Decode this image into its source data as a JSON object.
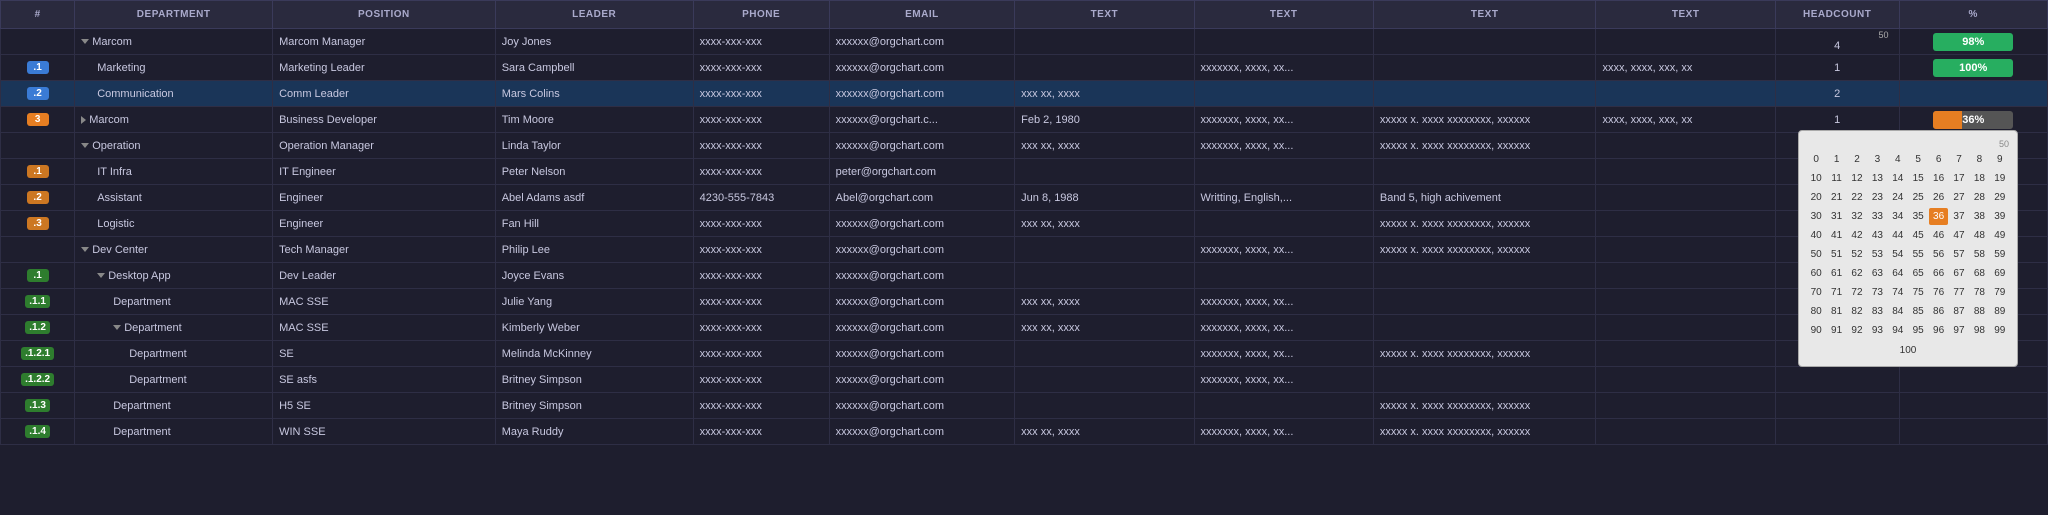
{
  "header": {
    "cols": [
      "#",
      "DEPARTMENT",
      "POSITION",
      "LEADER",
      "PHONE",
      "EMAIL",
      "TEXT",
      "TEXT",
      "TEXT",
      "TEXT",
      "HEADCOUNT",
      "%"
    ]
  },
  "headcount_50": "50",
  "rows": [
    {
      "id": "",
      "depth": 0,
      "dept": "Marcom",
      "pos": "Marcom Manager",
      "leader": "Joy Jones",
      "phone": "xxxx-xxx-xxx",
      "email": "xxxxxx@orgchart.com",
      "t1": "",
      "t2": "",
      "t3": "",
      "t4": "",
      "hc": "4",
      "pct": 98,
      "pct_label": "98%",
      "badge_color": "blue",
      "has_arrow": true,
      "arrow_type": "down",
      "row_style": ""
    },
    {
      "id": ".1",
      "depth": 1,
      "dept": "Marketing",
      "pos": "Marketing Leader",
      "leader": "Sara Campbell",
      "phone": "xxxx-xxx-xxx",
      "email": "xxxxxx@orgchart.com",
      "t1": "",
      "t2": "xxxxxxx, xxxx, xx...",
      "t3": "",
      "t4": "xxxx, xxxx, xxx, xx",
      "hc": "1",
      "pct": 100,
      "pct_label": "100%",
      "badge_color": "blue",
      "has_arrow": false,
      "row_style": "blue-indent"
    },
    {
      "id": ".2",
      "depth": 1,
      "dept": "Communication",
      "pos": "Comm Leader",
      "leader": "Mars Colins",
      "phone": "xxxx-xxx-xxx",
      "email": "xxxxxx@orgchart.com",
      "t1": "xxx xx, xxxx",
      "t2": "",
      "t3": "",
      "t4": "",
      "hc": "2",
      "pct": null,
      "pct_label": "",
      "badge_color": "blue",
      "has_arrow": false,
      "row_style": "selected-blue"
    },
    {
      "id": "3",
      "depth": 0,
      "dept": "Marcom",
      "pos": "Business Developer",
      "leader": "Tim Moore",
      "phone": "xxxx-xxx-xxx",
      "email": "xxxxxx@orgchart.c...",
      "t1": "Feb 2, 1980",
      "t2": "xxxxxxx, xxxx, xx...",
      "t3": "xxxxx x. xxxx xxxxxxxx, xxxxxx",
      "t4": "xxxx, xxxx, xxx, xx",
      "hc": "1",
      "pct": 36,
      "pct_label": "36%",
      "badge_color": "orange",
      "has_arrow": true,
      "arrow_type": "right",
      "row_style": ""
    },
    {
      "id": "",
      "depth": 0,
      "dept": "Operation",
      "pos": "Operation Manager",
      "leader": "Linda Taylor",
      "phone": "xxxx-xxx-xxx",
      "email": "xxxxxx@orgchart.com",
      "t1": "xxx xx, xxxx",
      "t2": "xxxxxxx, xxxx, xx...",
      "t3": "xxxxx x. xxxx xxxxxxxx, xxxxxx",
      "t4": "",
      "hc": "",
      "pct": null,
      "pct_label": "",
      "badge_color": "",
      "has_arrow": true,
      "arrow_type": "down",
      "row_style": ""
    },
    {
      "id": ".1",
      "depth": 1,
      "dept": "IT Infra",
      "pos": "IT Engineer",
      "leader": "Peter Nelson",
      "phone": "xxxx-xxx-xxx",
      "email": "peter@orgchart.com",
      "t1": "",
      "t2": "",
      "t3": "",
      "t4": "",
      "hc": "",
      "pct": null,
      "pct_label": "",
      "badge_color": "orange-ind",
      "has_arrow": false,
      "row_style": ""
    },
    {
      "id": ".2",
      "depth": 1,
      "dept": "Assistant",
      "pos": "Engineer",
      "leader": "Abel Adams asdf",
      "phone": "4230-555-7843",
      "email": "Abel@orgchart.com",
      "t1": "Jun 8, 1988",
      "t2": "Writting, English,...",
      "t3": "Band 5, high achivement",
      "t4": "",
      "hc": "",
      "pct": null,
      "pct_label": "",
      "badge_color": "orange-ind",
      "has_arrow": false,
      "row_style": ""
    },
    {
      "id": ".3",
      "depth": 1,
      "dept": "Logistic",
      "pos": "Engineer",
      "leader": "Fan Hill",
      "phone": "xxxx-xxx-xxx",
      "email": "xxxxxx@orgchart.com",
      "t1": "xxx xx, xxxx",
      "t2": "",
      "t3": "xxxxx x. xxxx xxxxxxxx, xxxxxx",
      "t4": "",
      "hc": "",
      "pct": null,
      "pct_label": "",
      "badge_color": "orange-ind",
      "has_arrow": false,
      "row_style": ""
    },
    {
      "id": "",
      "depth": 0,
      "dept": "Dev Center",
      "pos": "Tech Manager",
      "leader": "Philip Lee",
      "phone": "xxxx-xxx-xxx",
      "email": "xxxxxx@orgchart.com",
      "t1": "",
      "t2": "xxxxxxx, xxxx, xx...",
      "t3": "xxxxx x. xxxx xxxxxxxx, xxxxxx",
      "t4": "",
      "hc": "",
      "pct": null,
      "pct_label": "",
      "badge_color": "green-ind",
      "has_arrow": true,
      "arrow_type": "down",
      "row_style": ""
    },
    {
      "id": ".1",
      "depth": 1,
      "dept": "Desktop App",
      "pos": "Dev Leader",
      "leader": "Joyce Evans",
      "phone": "xxxx-xxx-xxx",
      "email": "xxxxxx@orgchart.com",
      "t1": "",
      "t2": "",
      "t3": "",
      "t4": "",
      "hc": "",
      "pct": null,
      "pct_label": "",
      "badge_color": "green-ind",
      "has_arrow": true,
      "arrow_type": "down",
      "row_style": ""
    },
    {
      "id": ".1.1",
      "depth": 2,
      "dept": "Department",
      "pos": "MAC SSE",
      "leader": "Julie Yang",
      "phone": "xxxx-xxx-xxx",
      "email": "xxxxxx@orgchart.com",
      "t1": "xxx xx, xxxx",
      "t2": "xxxxxxx, xxxx, xx...",
      "t3": "",
      "t4": "",
      "hc": "",
      "pct": null,
      "pct_label": "",
      "badge_color": "green-ind",
      "has_arrow": false,
      "row_style": ""
    },
    {
      "id": ".1.2",
      "depth": 2,
      "dept": "Department",
      "pos": "MAC SSE",
      "leader": "Kimberly Weber",
      "phone": "xxxx-xxx-xxx",
      "email": "xxxxxx@orgchart.com",
      "t1": "xxx xx, xxxx",
      "t2": "xxxxxxx, xxxx, xx...",
      "t3": "",
      "t4": "",
      "hc": "",
      "pct": null,
      "pct_label": "",
      "badge_color": "green-ind",
      "has_arrow": true,
      "arrow_type": "down",
      "row_style": ""
    },
    {
      "id": ".1.2.1",
      "depth": 3,
      "dept": "Department",
      "pos": "SE",
      "leader": "Melinda McKinney",
      "phone": "xxxx-xxx-xxx",
      "email": "xxxxxx@orgchart.com",
      "t1": "",
      "t2": "xxxxxxx, xxxx, xx...",
      "t3": "xxxxx x. xxxx xxxxxxxx, xxxxxx",
      "t4": "",
      "hc": "",
      "pct": null,
      "pct_label": "",
      "badge_color": "green-ind",
      "has_arrow": false,
      "row_style": ""
    },
    {
      "id": ".1.2.2",
      "depth": 3,
      "dept": "Department",
      "pos": "SE asfs",
      "leader": "Britney Simpson",
      "phone": "xxxx-xxx-xxx",
      "email": "xxxxxx@orgchart.com",
      "t1": "",
      "t2": "xxxxxxx, xxxx, xx...",
      "t3": "",
      "t4": "",
      "hc": "",
      "pct": null,
      "pct_label": "",
      "badge_color": "green-ind",
      "has_arrow": false,
      "row_style": ""
    },
    {
      "id": ".1.3",
      "depth": 2,
      "dept": "Department",
      "pos": "H5 SE",
      "leader": "Britney Simpson",
      "phone": "xxxx-xxx-xxx",
      "email": "xxxxxx@orgchart.com",
      "t1": "",
      "t2": "",
      "t3": "xxxxx x. xxxx xxxxxxxx, xxxxxx",
      "t4": "",
      "hc": "",
      "pct": null,
      "pct_label": "",
      "badge_color": "green-ind",
      "has_arrow": false,
      "row_style": ""
    },
    {
      "id": ".1.4",
      "depth": 2,
      "dept": "Department",
      "pos": "WIN SSE",
      "leader": "Maya Ruddy",
      "phone": "xxxx-xxx-xxx",
      "email": "xxxxxx@orgchart.com",
      "t1": "xxx xx, xxxx",
      "t2": "xxxxxxx, xxxx, xx...",
      "t3": "xxxxx x. xxxx xxxxxxxx, xxxxxx",
      "t4": "",
      "hc": "",
      "pct": null,
      "pct_label": "",
      "badge_color": "green-ind",
      "has_arrow": false,
      "row_style": ""
    }
  ],
  "number_picker": {
    "visible": true,
    "selected": 36,
    "numbers": [
      [
        0,
        1,
        2,
        3,
        4,
        5,
        6,
        7,
        8,
        9
      ],
      [
        10,
        11,
        12,
        13,
        14,
        15,
        16,
        17,
        18,
        19
      ],
      [
        20,
        21,
        22,
        23,
        24,
        25,
        26,
        27,
        28,
        29
      ],
      [
        30,
        31,
        32,
        33,
        34,
        35,
        36,
        37,
        38,
        39
      ],
      [
        40,
        41,
        42,
        43,
        44,
        45,
        46,
        47,
        48,
        49
      ],
      [
        50,
        51,
        52,
        53,
        54,
        55,
        56,
        57,
        58,
        59
      ],
      [
        60,
        61,
        62,
        63,
        64,
        65,
        66,
        67,
        68,
        69
      ],
      [
        70,
        71,
        72,
        73,
        74,
        75,
        76,
        77,
        78,
        79
      ],
      [
        80,
        81,
        82,
        83,
        84,
        85,
        86,
        87,
        88,
        89
      ],
      [
        90,
        91,
        92,
        93,
        94,
        95,
        96,
        97,
        98,
        99
      ]
    ],
    "hundred_label": "100"
  },
  "badge_colors": {
    "blue": "#3a7bd5",
    "orange": "#cc7722",
    "green": "#27ae60",
    "orange_bar": "#e67e22"
  }
}
